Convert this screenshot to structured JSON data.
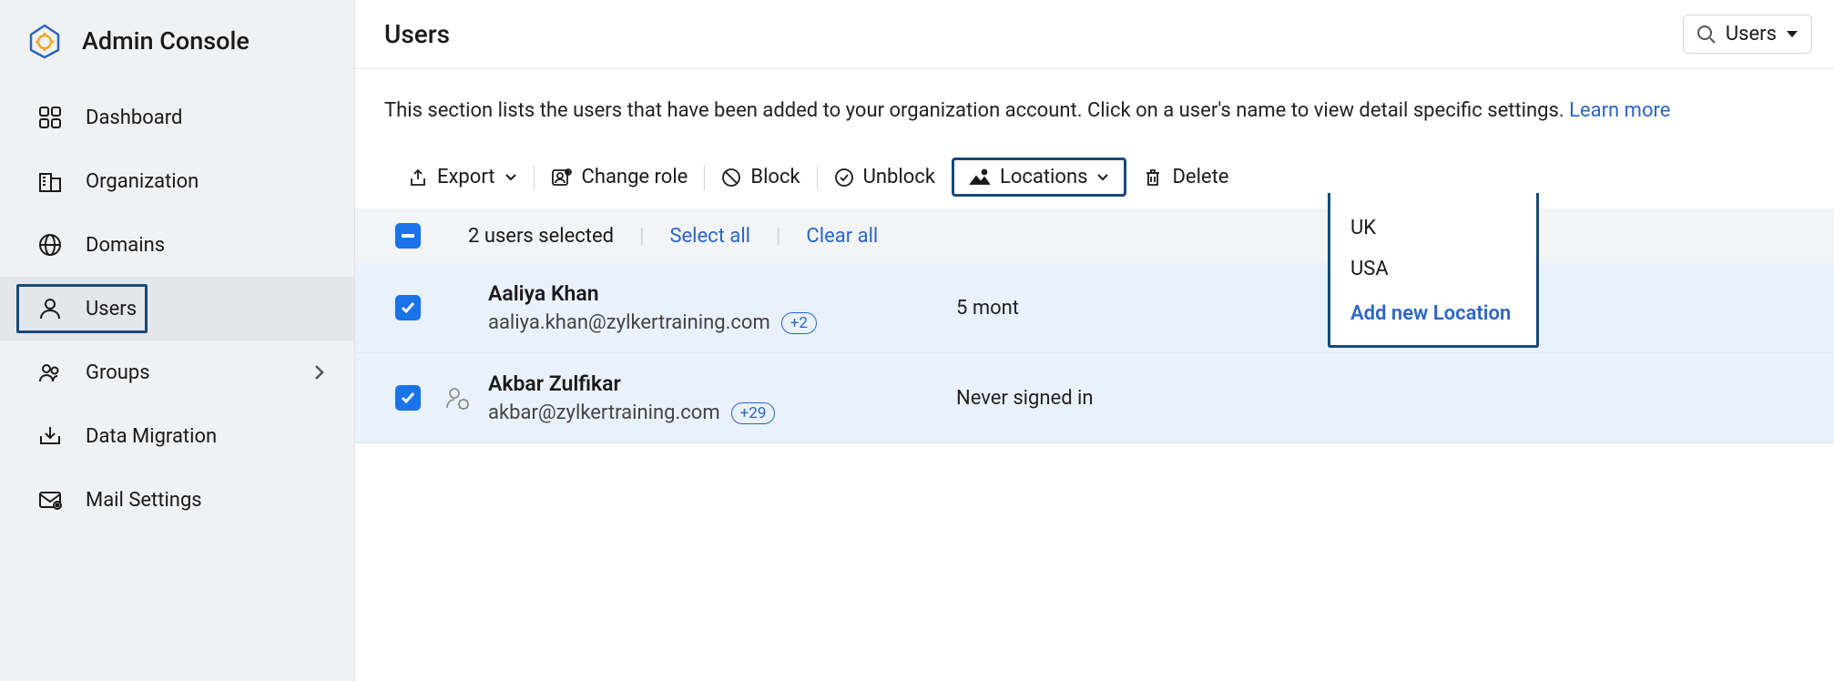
{
  "brand": {
    "title": "Admin Console"
  },
  "sidebar": {
    "items": [
      {
        "label": "Dashboard"
      },
      {
        "label": "Organization"
      },
      {
        "label": "Domains"
      },
      {
        "label": "Users"
      },
      {
        "label": "Groups"
      },
      {
        "label": "Data Migration"
      },
      {
        "label": "Mail Settings"
      }
    ]
  },
  "header": {
    "title": "Users",
    "search_scope": "Users"
  },
  "intro": {
    "text": "This section lists the users that have been added to your organization account. Click on a user's name to view detail specific settings. ",
    "learn_more": "Learn more"
  },
  "toolbar": {
    "export": "Export",
    "change_role": "Change role",
    "block": "Block",
    "unblock": "Unblock",
    "locations": "Locations",
    "delete": "Delete"
  },
  "locations_dropdown": {
    "options": [
      "UK",
      "USA"
    ],
    "add_label": "Add new Location"
  },
  "selection": {
    "count_text": "2 users selected",
    "select_all": "Select all",
    "clear_all": "Clear all"
  },
  "users": [
    {
      "name": "Aaliya Khan",
      "email": "aaliya.khan@zylkertraining.com",
      "extra_count": "+2",
      "meta": "5 mont",
      "has_gear": false
    },
    {
      "name": "Akbar Zulfikar",
      "email": "akbar@zylkertraining.com",
      "extra_count": "+29",
      "meta": "Never signed in",
      "has_gear": true
    }
  ]
}
